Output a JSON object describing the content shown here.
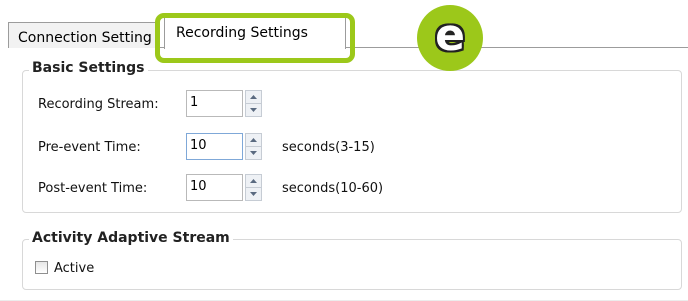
{
  "tabs": [
    {
      "label": "Connection Setting",
      "active": false
    },
    {
      "label": "Recording Settings",
      "active": true
    }
  ],
  "annotation": {
    "badge_letter": "e",
    "highlight_color": "#9cc81a"
  },
  "basic_settings": {
    "title": "Basic Settings",
    "rows": [
      {
        "label": "Recording Stream:",
        "value": "1",
        "unit": ""
      },
      {
        "label": "Pre-event Time:",
        "value": "10",
        "unit": "seconds(3-15)"
      },
      {
        "label": "Post-event Time:",
        "value": "10",
        "unit": "seconds(10-60)"
      }
    ]
  },
  "activity_adaptive_stream": {
    "title": "Activity Adaptive Stream",
    "checkbox_label": "Active",
    "checked": false
  },
  "icons": {
    "spinner_up": "triangle-up-icon",
    "spinner_down": "triangle-down-icon"
  }
}
